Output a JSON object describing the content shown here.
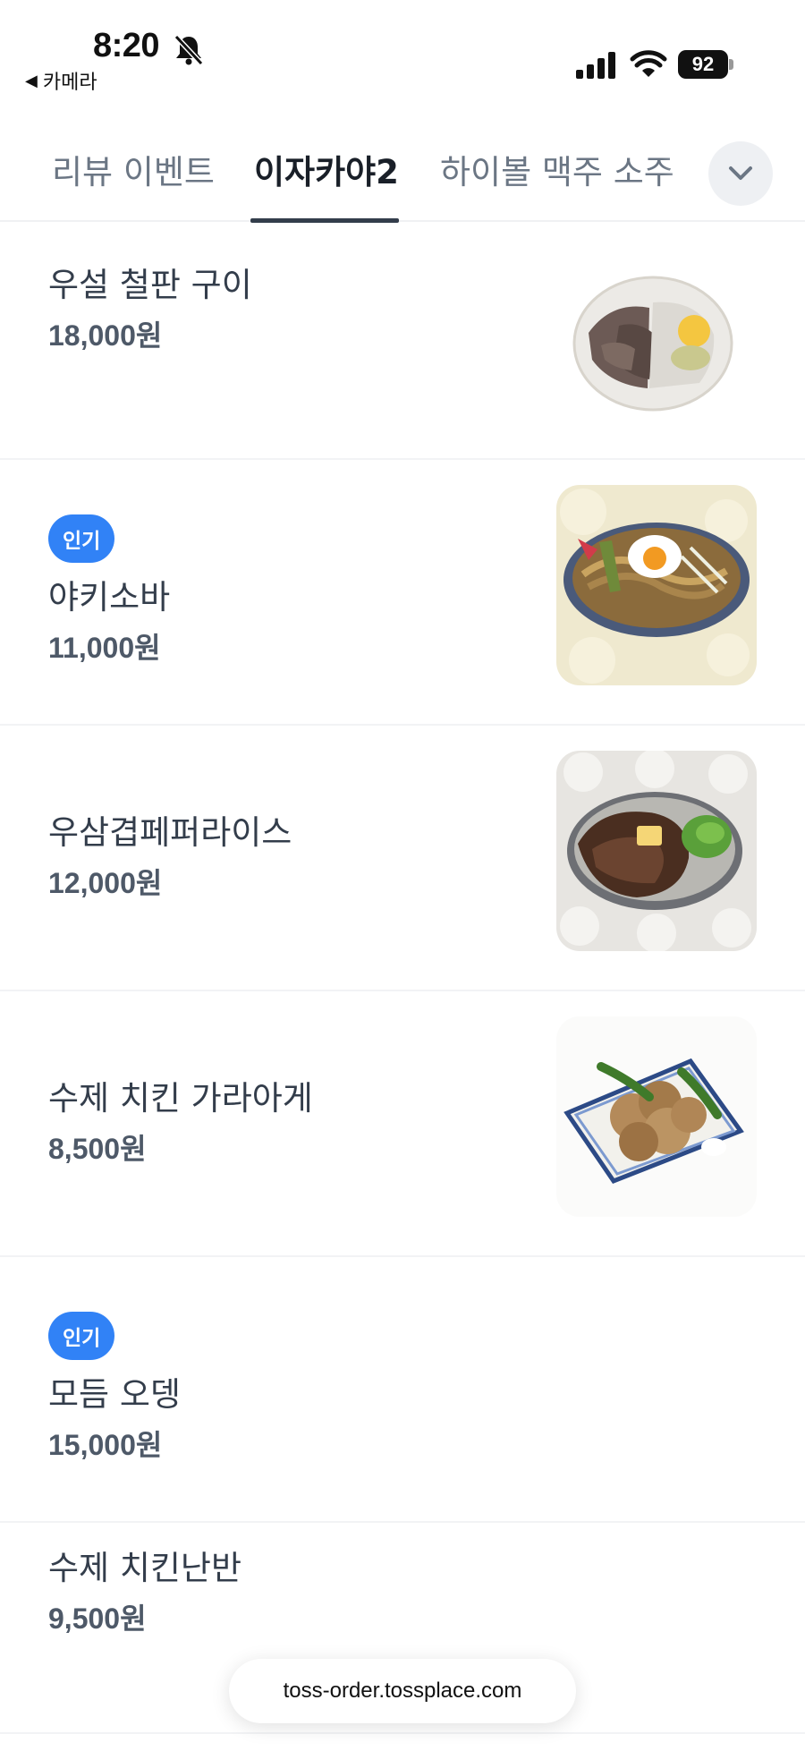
{
  "status_bar": {
    "time": "8:20",
    "back_label": "카메라",
    "back_arrow": "◀",
    "battery": "92",
    "icons": [
      "bell-slash-icon",
      "signal-icon",
      "wifi-icon",
      "battery-icon"
    ]
  },
  "tabs": {
    "items": [
      {
        "label": "리뷰 이벤트"
      },
      {
        "label": "이자카야2"
      },
      {
        "label": "하이볼 맥주 소주"
      }
    ],
    "active_index": 1,
    "more_icon": "chevron-down-icon"
  },
  "menu": {
    "items": [
      {
        "name": "우설 철판 구이",
        "price": "18,000원",
        "badge": "",
        "image": "beef-tongue-plate"
      },
      {
        "name": "야키소바",
        "price": "11,000원",
        "badge": "인기",
        "image": "yakisoba-plate"
      },
      {
        "name": "우삼겹페퍼라이스",
        "price": "12,000원",
        "badge": "",
        "image": "pepper-rice-plate"
      },
      {
        "name": "수제 치킨 가라아게",
        "price": "8,500원",
        "badge": "",
        "image": "karaage-plate"
      },
      {
        "name": "모듬 오뎅",
        "price": "15,000원",
        "badge": "인기",
        "image": ""
      },
      {
        "name": "수제 치킨난반",
        "price": "9,500원",
        "badge": "",
        "image": ""
      }
    ]
  },
  "url_bar": {
    "url": "toss-order.tossplace.com"
  },
  "colors": {
    "accent": "#3182f6",
    "text_primary": "#333d4b",
    "text_secondary": "#6b7684",
    "divider": "#f2f3f5"
  }
}
